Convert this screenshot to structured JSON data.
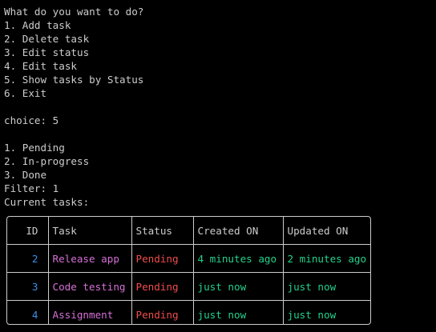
{
  "menu": {
    "prompt": "What do you want to do?",
    "options": [
      "1. Add task",
      "2. Delete task",
      "3. Edit status",
      "4. Edit task",
      "5. Show tasks by Status",
      "6. Exit"
    ]
  },
  "choice_line": "choice: 5",
  "status_options": [
    "1. Pending",
    "2. In-progress",
    "3. Done"
  ],
  "filter_line": "Filter: 1",
  "current_tasks_label": "Current tasks:",
  "table": {
    "headers": [
      "ID",
      "Task",
      "Status",
      "Created ON",
      "Updated ON"
    ],
    "rows": [
      [
        "2",
        "Release app",
        "Pending",
        "4 minutes ago",
        "2 minutes ago"
      ],
      [
        "3",
        "Code testing",
        "Pending",
        "just now",
        "just now"
      ],
      [
        "4",
        "Assignment",
        "Pending",
        "just now",
        "just now"
      ]
    ]
  },
  "colors": {
    "background": "#000000",
    "text": "#cccccc",
    "id": "#3b8eea",
    "task": "#d670d6",
    "status": "#f14c4c",
    "time": "#23d18b"
  }
}
